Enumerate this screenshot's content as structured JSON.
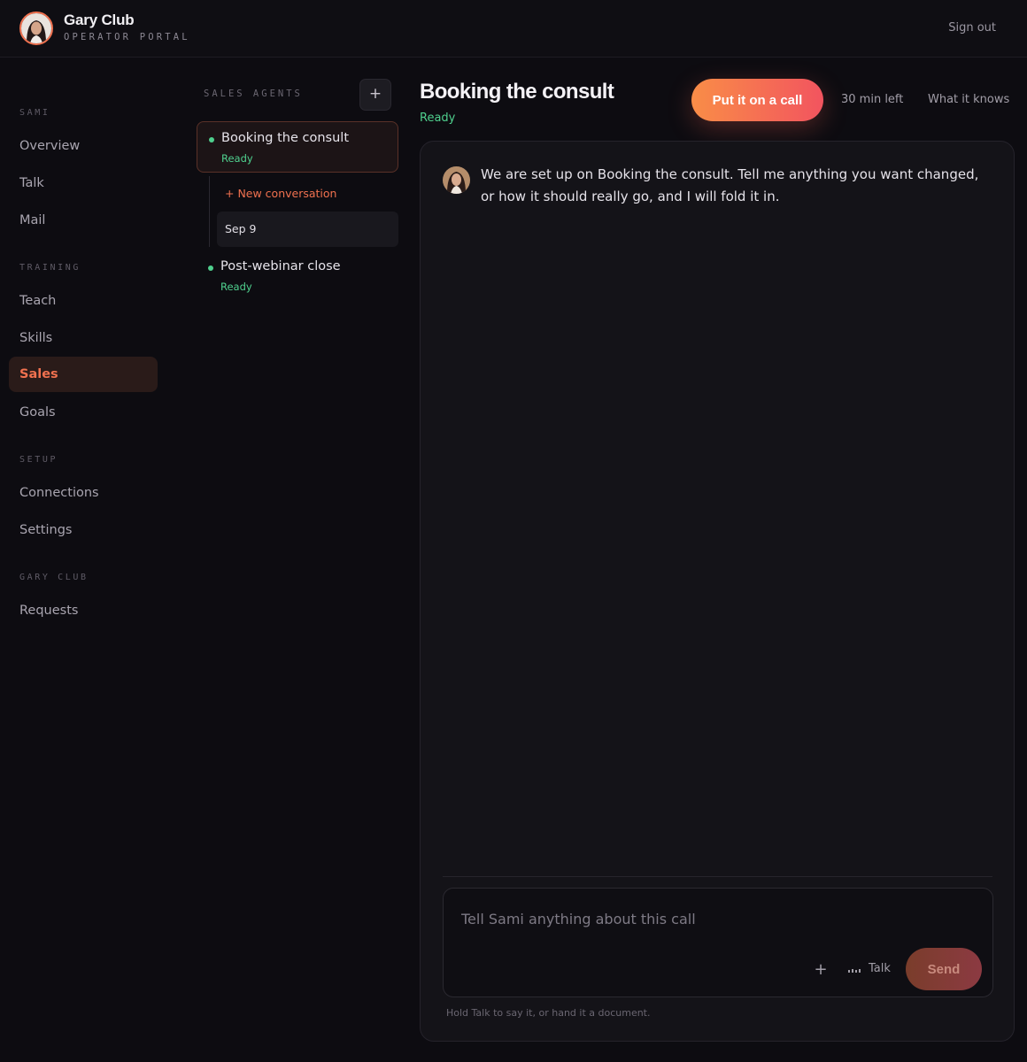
{
  "brand": {
    "title": "Gary Club",
    "subtitle": "OPERATOR PORTAL"
  },
  "header": {
    "sign_out": "Sign out"
  },
  "sidebar": {
    "sections": [
      {
        "heading": "SAMI",
        "items": [
          {
            "label": "Overview",
            "active": false
          },
          {
            "label": "Talk",
            "active": false
          },
          {
            "label": "Mail",
            "active": false
          }
        ]
      },
      {
        "heading": "TRAINING",
        "items": [
          {
            "label": "Teach",
            "active": false
          },
          {
            "label": "Skills",
            "active": false
          },
          {
            "label": "Sales",
            "active": true
          },
          {
            "label": "Goals",
            "active": false
          }
        ]
      },
      {
        "heading": "SETUP",
        "items": [
          {
            "label": "Connections",
            "active": false
          },
          {
            "label": "Settings",
            "active": false
          }
        ]
      },
      {
        "heading": "GARY CLUB",
        "items": [
          {
            "label": "Requests",
            "active": false
          }
        ]
      }
    ]
  },
  "agents": {
    "title": "SALES AGENTS",
    "add_icon": "plus-icon",
    "list": [
      {
        "name": "Booking the consult",
        "status": "Ready",
        "selected": true
      },
      {
        "name": "Post-webinar close",
        "status": "Ready",
        "selected": false
      }
    ],
    "new_conversation": "+ New conversation",
    "conversations": [
      "Sep 9"
    ]
  },
  "main": {
    "title": "Booking the consult",
    "status": "Ready",
    "call_button": "Put it on a call",
    "time_left": "30 min left",
    "what_it_knows": "What it knows"
  },
  "chat": {
    "messages": [
      {
        "text": "We are set up on Booking the consult. Tell me anything you want changed, or how it should really go, and I will fold it in."
      }
    ],
    "composer": {
      "placeholder": "Tell Sami anything about this call",
      "value": "",
      "talk_label": "Talk",
      "send_label": "Send",
      "hint": "Hold Talk to say it, or hand it a document."
    }
  },
  "colors": {
    "background": "#0d0c11",
    "accent": "#f0714f",
    "ready": "#4fd08e",
    "panel": "#141318"
  }
}
